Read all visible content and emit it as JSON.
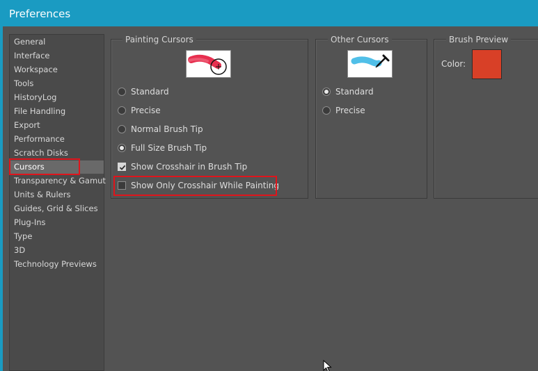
{
  "window": {
    "title": "Preferences"
  },
  "sidebar": {
    "items": [
      {
        "label": "General"
      },
      {
        "label": "Interface"
      },
      {
        "label": "Workspace"
      },
      {
        "label": "Tools"
      },
      {
        "label": "HistoryLog"
      },
      {
        "label": "File Handling"
      },
      {
        "label": "Export"
      },
      {
        "label": "Performance"
      },
      {
        "label": "Scratch Disks"
      },
      {
        "label": "Cursors",
        "selected": true
      },
      {
        "label": "Transparency & Gamut"
      },
      {
        "label": "Units & Rulers"
      },
      {
        "label": "Guides, Grid & Slices"
      },
      {
        "label": "Plug-Ins"
      },
      {
        "label": "Type"
      },
      {
        "label": "3D"
      },
      {
        "label": "Technology Previews"
      }
    ]
  },
  "painting_cursors": {
    "title": "Painting Cursors",
    "options": [
      {
        "label": "Standard",
        "checked": false
      },
      {
        "label": "Precise",
        "checked": false
      },
      {
        "label": "Normal Brush Tip",
        "checked": false
      },
      {
        "label": "Full Size Brush Tip",
        "checked": true
      }
    ],
    "show_crosshair": {
      "label": "Show Crosshair in Brush Tip",
      "checked": true
    },
    "show_only_crosshair": {
      "label": "Show Only Crosshair While Painting",
      "checked": false
    }
  },
  "other_cursors": {
    "title": "Other Cursors",
    "options": [
      {
        "label": "Standard",
        "checked": true
      },
      {
        "label": "Precise",
        "checked": false
      }
    ]
  },
  "brush_preview": {
    "title": "Brush Preview",
    "color_label": "Color:",
    "color": "#d84027"
  },
  "colors": {
    "accent": "#1a9bc2",
    "highlight": "#e0141b"
  }
}
